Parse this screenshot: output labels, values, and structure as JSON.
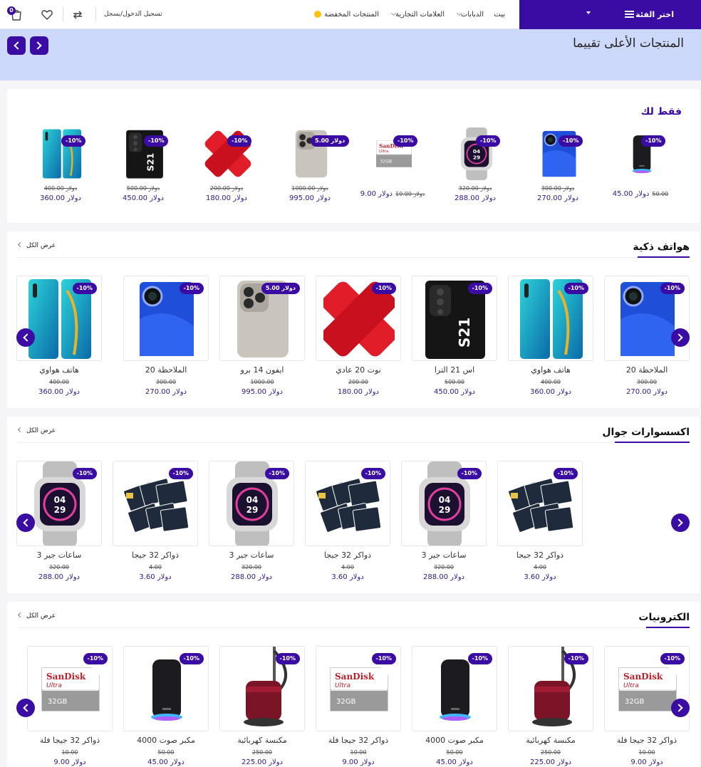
{
  "header": {
    "category_button": "اختر الفئة",
    "nav": {
      "home": "بيت",
      "bikes": "الدبابات",
      "brands": "العلامات التجارية",
      "offers": "المنتجات المخفضة"
    },
    "login": "تسجيل الدخول/يسجل",
    "cart_count": "0"
  },
  "hero": {
    "title": "المنتجات الأعلى تقييما"
  },
  "colors": {
    "accent": "#3a0ca3",
    "hero_bg": "#ccd9fa",
    "offers_dot": "#ffc107"
  },
  "just_for_you": {
    "title": "فقط لك",
    "items": [
      {
        "image": "speaker-product",
        "badge": "-10%",
        "old": "50.00",
        "new": "45.00 دولار"
      },
      {
        "image": "blue-phone-product",
        "badge": "-10%",
        "old": "300.00 دولار",
        "new": "270.00 دولار"
      },
      {
        "image": "smartwatch-product",
        "badge": "-10%",
        "old": "320.00 دولار",
        "new": "288.00 دولار"
      },
      {
        "image": "sd-card-product",
        "badge": "-10%",
        "old": "10.00 دولار",
        "new": "9.00 دولار"
      },
      {
        "image": "iphone-product",
        "badge": "5.00 دولار",
        "old": "1000.00 دولار",
        "new": "995.00 دولار"
      },
      {
        "image": "red-case-product",
        "badge": "-10%",
        "old": "200.00 دولار",
        "new": "180.00 دولار"
      },
      {
        "image": "s21-product",
        "badge": "-10%",
        "old": "500.00 دولار",
        "new": "450.00 دولار"
      },
      {
        "image": "p30-product",
        "badge": "-10%",
        "old": "400.00 دولار",
        "new": "360.00 دولار"
      }
    ]
  },
  "smartphones": {
    "title": "هواتف ذكية",
    "view_all": "عرض الكل",
    "items": [
      {
        "image": "blue-phone-product",
        "badge": "-10%",
        "name": "الملاحظة 20",
        "old": "300.00",
        "new": "270.00 دولار"
      },
      {
        "image": "p30-product",
        "badge": "-10%",
        "name": "هاتف هواوي",
        "old": "400.00",
        "new": "360.00 دولار"
      },
      {
        "image": "s21-product",
        "badge": "-10%",
        "name": "اس 21 الترا",
        "old": "500.00",
        "new": "450.00 دولار"
      },
      {
        "image": "red-case-product",
        "badge": "-10%",
        "name": "نوت 20 عادي",
        "old": "200.00",
        "new": "180.00 دولار"
      },
      {
        "image": "iphone-product",
        "badge": "5.00 دولار",
        "name": "ايفون 14 برو",
        "old": "1000.00",
        "new": "995.00 دولار"
      },
      {
        "image": "blue-phone-product",
        "badge": "-10%",
        "name": "الملاحظة 20",
        "old": "300.00",
        "new": "270.00 دولار"
      },
      {
        "image": "p30-product",
        "badge": "-10%",
        "name": "هاتف هواوي",
        "old": "400.00",
        "new": "360.00 دولار"
      }
    ]
  },
  "accessories": {
    "title": "اكسسوارات جوال",
    "view_all": "عرض الكل",
    "items": [
      {
        "image": "sd-cards-product",
        "badge": "-10%",
        "name": "ذواكر 32 جيجا",
        "old": "4.00",
        "new": "3.60 دولار"
      },
      {
        "image": "smartwatch-product",
        "badge": "-10%",
        "name": "ساعات جير 3",
        "old": "320.00",
        "new": "288.00 دولار"
      },
      {
        "image": "sd-cards-product",
        "badge": "-10%",
        "name": "ذواكر 32 جيجا",
        "old": "4.00",
        "new": "3.60 دولار"
      },
      {
        "image": "smartwatch-product",
        "badge": "-10%",
        "name": "ساعات جير 3",
        "old": "320.00",
        "new": "288.00 دولار"
      },
      {
        "image": "sd-cards-product",
        "badge": "-10%",
        "name": "ذواكر 32 جيجا",
        "old": "4.00",
        "new": "3.60 دولار"
      },
      {
        "image": "smartwatch-product",
        "badge": "-10%",
        "name": "ساعات جير 3",
        "old": "320.00",
        "new": "288.00 دولار"
      }
    ]
  },
  "electronics": {
    "title": "الكترونيات",
    "view_all": "عرض الكل",
    "items": [
      {
        "image": "sd-card-product",
        "badge": "-10%",
        "name": "ذواكر 32 جيجا فلة",
        "old": "10.00",
        "new": "9.00 دولار"
      },
      {
        "image": "vacuum-product",
        "badge": "-10%",
        "name": "مكنسة كهربائية",
        "old": "250.00",
        "new": "225.00 دولار"
      },
      {
        "image": "speaker-product",
        "badge": "-10%",
        "name": "مكبر صوت 4000",
        "old": "50.00",
        "new": "45.00 دولار"
      },
      {
        "image": "sd-card-product",
        "badge": "-10%",
        "name": "ذواكر 32 جيجا فلة",
        "old": "10.00",
        "new": "9.00 دولار"
      },
      {
        "image": "vacuum-product",
        "badge": "-10%",
        "name": "مكنسة كهربائية",
        "old": "250.00",
        "new": "225.00 دولار"
      },
      {
        "image": "speaker-product",
        "badge": "-10%",
        "name": "مكبر صوت 4000",
        "old": "50.00",
        "new": "45.00 دولار"
      },
      {
        "image": "sd-card-product",
        "badge": "-10%",
        "name": "ذواكر 32 جيجا فلة",
        "old": "10.00",
        "new": "9.00 دولار"
      }
    ]
  }
}
